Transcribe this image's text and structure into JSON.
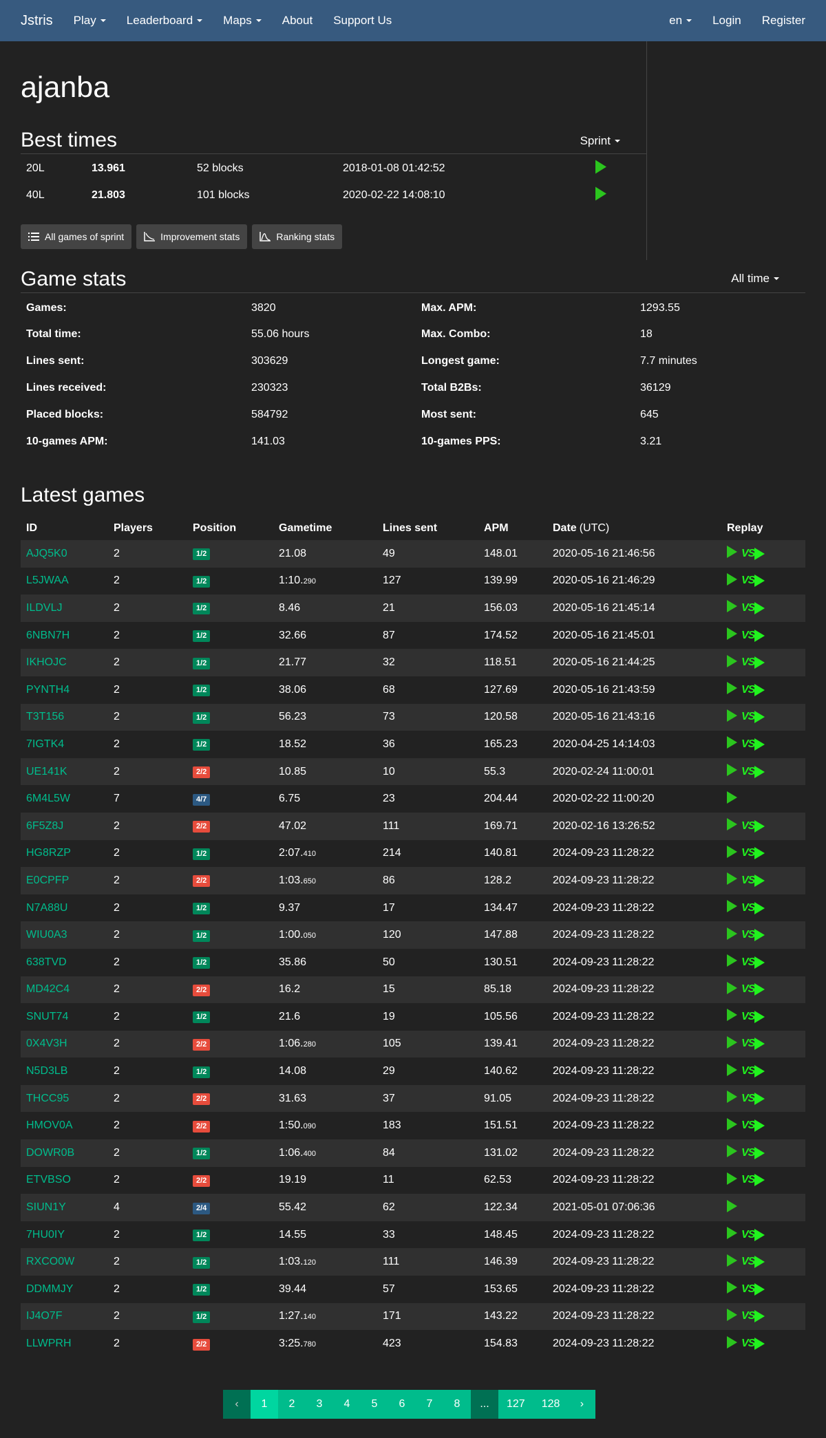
{
  "nav": {
    "brand": "Jstris",
    "items": [
      "Play",
      "Leaderboard",
      "Maps",
      "About",
      "Support Us"
    ],
    "right": {
      "lang": "en",
      "login": "Login",
      "register": "Register"
    }
  },
  "profile": {
    "username": "ajanba"
  },
  "best_times": {
    "title": "Best times",
    "mode": "Sprint",
    "rows": [
      {
        "mode": "20L",
        "time": "13.961",
        "blocks": "52 blocks",
        "date": "2018-01-08 01:42:52"
      },
      {
        "mode": "40L",
        "time": "21.803",
        "blocks": "101 blocks",
        "date": "2020-02-22 14:08:10"
      }
    ],
    "buttons": [
      "All games of sprint",
      "Improvement stats",
      "Ranking stats"
    ]
  },
  "game_stats": {
    "title": "Game stats",
    "period": "All time",
    "rows": [
      {
        "l1": "Games:",
        "v1": "3820",
        "l2": "Max. APM:",
        "v2": "1293.55"
      },
      {
        "l1": "Total time:",
        "v1": "55.06 hours",
        "l2": "Max. Combo:",
        "v2": "18"
      },
      {
        "l1": "Lines sent:",
        "v1": "303629",
        "l2": "Longest game:",
        "v2": "7.7 minutes"
      },
      {
        "l1": "Lines received:",
        "v1": "230323",
        "l2": "Total B2Bs:",
        "v2": "36129"
      },
      {
        "l1": "Placed blocks:",
        "v1": "584792",
        "l2": "Most sent:",
        "v2": "645"
      },
      {
        "l1": "10-games APM:",
        "v1": "141.03",
        "l2": "10-games PPS:",
        "v2": "3.21"
      }
    ]
  },
  "latest_games": {
    "title": "Latest games",
    "headers": [
      "ID",
      "Players",
      "Position",
      "Gametime",
      "Lines sent",
      "APM",
      "Date",
      "(UTC)",
      "Replay"
    ],
    "rows": [
      {
        "id": "AJQ5K0",
        "players": "2",
        "pos": "1/2",
        "posColor": "green",
        "time": "21.08",
        "ms": "",
        "lines": "49",
        "apm": "148.01",
        "date": "2020-05-16 21:46:56",
        "vs": true
      },
      {
        "id": "L5JWAA",
        "players": "2",
        "pos": "1/2",
        "posColor": "green",
        "time": "1:10.",
        "ms": "290",
        "lines": "127",
        "apm": "139.99",
        "date": "2020-05-16 21:46:29",
        "vs": true
      },
      {
        "id": "ILDVLJ",
        "players": "2",
        "pos": "1/2",
        "posColor": "green",
        "time": "8.46",
        "ms": "",
        "lines": "21",
        "apm": "156.03",
        "date": "2020-05-16 21:45:14",
        "vs": true
      },
      {
        "id": "6NBN7H",
        "players": "2",
        "pos": "1/2",
        "posColor": "green",
        "time": "32.66",
        "ms": "",
        "lines": "87",
        "apm": "174.52",
        "date": "2020-05-16 21:45:01",
        "vs": true
      },
      {
        "id": "IKHOJC",
        "players": "2",
        "pos": "1/2",
        "posColor": "green",
        "time": "21.77",
        "ms": "",
        "lines": "32",
        "apm": "118.51",
        "date": "2020-05-16 21:44:25",
        "vs": true
      },
      {
        "id": "PYNTH4",
        "players": "2",
        "pos": "1/2",
        "posColor": "green",
        "time": "38.06",
        "ms": "",
        "lines": "68",
        "apm": "127.69",
        "date": "2020-05-16 21:43:59",
        "vs": true
      },
      {
        "id": "T3T156",
        "players": "2",
        "pos": "1/2",
        "posColor": "green",
        "time": "56.23",
        "ms": "",
        "lines": "73",
        "apm": "120.58",
        "date": "2020-05-16 21:43:16",
        "vs": true
      },
      {
        "id": "7IGTK4",
        "players": "2",
        "pos": "1/2",
        "posColor": "green",
        "time": "18.52",
        "ms": "",
        "lines": "36",
        "apm": "165.23",
        "date": "2020-04-25 14:14:03",
        "vs": true
      },
      {
        "id": "UE141K",
        "players": "2",
        "pos": "2/2",
        "posColor": "red",
        "time": "10.85",
        "ms": "",
        "lines": "10",
        "apm": "55.3",
        "date": "2020-02-24 11:00:01",
        "vs": true
      },
      {
        "id": "6M4L5W",
        "players": "7",
        "pos": "4/7",
        "posColor": "blue",
        "time": "6.75",
        "ms": "",
        "lines": "23",
        "apm": "204.44",
        "date": "2020-02-22 11:00:20",
        "vs": false
      },
      {
        "id": "6F5Z8J",
        "players": "2",
        "pos": "2/2",
        "posColor": "red",
        "time": "47.02",
        "ms": "",
        "lines": "111",
        "apm": "169.71",
        "date": "2020-02-16 13:26:52",
        "vs": true
      },
      {
        "id": "HG8RZP",
        "players": "2",
        "pos": "1/2",
        "posColor": "green",
        "time": "2:07.",
        "ms": "410",
        "lines": "214",
        "apm": "140.81",
        "date": "2024-09-23 11:28:22",
        "vs": true
      },
      {
        "id": "E0CPFP",
        "players": "2",
        "pos": "2/2",
        "posColor": "red",
        "time": "1:03.",
        "ms": "650",
        "lines": "86",
        "apm": "128.2",
        "date": "2024-09-23 11:28:22",
        "vs": true
      },
      {
        "id": "N7A88U",
        "players": "2",
        "pos": "1/2",
        "posColor": "green",
        "time": "9.37",
        "ms": "",
        "lines": "17",
        "apm": "134.47",
        "date": "2024-09-23 11:28:22",
        "vs": true
      },
      {
        "id": "WIU0A3",
        "players": "2",
        "pos": "1/2",
        "posColor": "green",
        "time": "1:00.",
        "ms": "050",
        "lines": "120",
        "apm": "147.88",
        "date": "2024-09-23 11:28:22",
        "vs": true
      },
      {
        "id": "638TVD",
        "players": "2",
        "pos": "1/2",
        "posColor": "green",
        "time": "35.86",
        "ms": "",
        "lines": "50",
        "apm": "130.51",
        "date": "2024-09-23 11:28:22",
        "vs": true
      },
      {
        "id": "MD42C4",
        "players": "2",
        "pos": "2/2",
        "posColor": "red",
        "time": "16.2",
        "ms": "",
        "lines": "15",
        "apm": "85.18",
        "date": "2024-09-23 11:28:22",
        "vs": true
      },
      {
        "id": "SNUT74",
        "players": "2",
        "pos": "1/2",
        "posColor": "green",
        "time": "21.6",
        "ms": "",
        "lines": "19",
        "apm": "105.56",
        "date": "2024-09-23 11:28:22",
        "vs": true
      },
      {
        "id": "0X4V3H",
        "players": "2",
        "pos": "2/2",
        "posColor": "red",
        "time": "1:06.",
        "ms": "280",
        "lines": "105",
        "apm": "139.41",
        "date": "2024-09-23 11:28:22",
        "vs": true
      },
      {
        "id": "N5D3LB",
        "players": "2",
        "pos": "1/2",
        "posColor": "green",
        "time": "14.08",
        "ms": "",
        "lines": "29",
        "apm": "140.62",
        "date": "2024-09-23 11:28:22",
        "vs": true
      },
      {
        "id": "THCC95",
        "players": "2",
        "pos": "2/2",
        "posColor": "red",
        "time": "31.63",
        "ms": "",
        "lines": "37",
        "apm": "91.05",
        "date": "2024-09-23 11:28:22",
        "vs": true
      },
      {
        "id": "HMOV0A",
        "players": "2",
        "pos": "2/2",
        "posColor": "red",
        "time": "1:50.",
        "ms": "090",
        "lines": "183",
        "apm": "151.51",
        "date": "2024-09-23 11:28:22",
        "vs": true
      },
      {
        "id": "DOWR0B",
        "players": "2",
        "pos": "1/2",
        "posColor": "green",
        "time": "1:06.",
        "ms": "400",
        "lines": "84",
        "apm": "131.02",
        "date": "2024-09-23 11:28:22",
        "vs": true
      },
      {
        "id": "ETVBSO",
        "players": "2",
        "pos": "2/2",
        "posColor": "red",
        "time": "19.19",
        "ms": "",
        "lines": "11",
        "apm": "62.53",
        "date": "2024-09-23 11:28:22",
        "vs": true
      },
      {
        "id": "SIUN1Y",
        "players": "4",
        "pos": "2/4",
        "posColor": "blue",
        "time": "55.42",
        "ms": "",
        "lines": "62",
        "apm": "122.34",
        "date": "2021-05-01 07:06:36",
        "vs": false
      },
      {
        "id": "7HU0IY",
        "players": "2",
        "pos": "1/2",
        "posColor": "green",
        "time": "14.55",
        "ms": "",
        "lines": "33",
        "apm": "148.45",
        "date": "2024-09-23 11:28:22",
        "vs": true
      },
      {
        "id": "RXCO0W",
        "players": "2",
        "pos": "1/2",
        "posColor": "green",
        "time": "1:03.",
        "ms": "120",
        "lines": "111",
        "apm": "146.39",
        "date": "2024-09-23 11:28:22",
        "vs": true
      },
      {
        "id": "DDMMJY",
        "players": "2",
        "pos": "1/2",
        "posColor": "green",
        "time": "39.44",
        "ms": "",
        "lines": "57",
        "apm": "153.65",
        "date": "2024-09-23 11:28:22",
        "vs": true
      },
      {
        "id": "IJ4O7F",
        "players": "2",
        "pos": "1/2",
        "posColor": "green",
        "time": "1:27.",
        "ms": "140",
        "lines": "171",
        "apm": "143.22",
        "date": "2024-09-23 11:28:22",
        "vs": true
      },
      {
        "id": "LLWPRH",
        "players": "2",
        "pos": "2/2",
        "posColor": "red",
        "time": "3:25.",
        "ms": "780",
        "lines": "423",
        "apm": "154.83",
        "date": "2024-09-23 11:28:22",
        "vs": true
      }
    ]
  },
  "pagination": {
    "prev": "‹",
    "next": "›",
    "pages": [
      "1",
      "2",
      "3",
      "4",
      "5",
      "6",
      "7",
      "8"
    ],
    "ellipsis": "...",
    "last": [
      "127",
      "128"
    ],
    "active": "1"
  },
  "colors": {
    "navbar": "#375a7f",
    "accent": "#00bc8c",
    "background": "#222222",
    "play": "#2bc51e"
  },
  "icons": {
    "best_play": "play-icon",
    "vs": "vs-replay-icon"
  }
}
